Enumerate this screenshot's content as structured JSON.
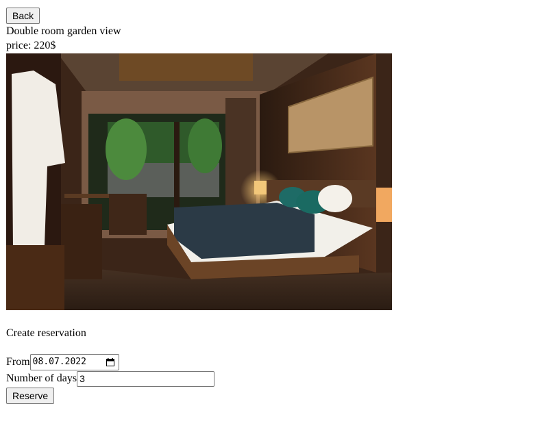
{
  "nav": {
    "back_label": "Back"
  },
  "room": {
    "name": "Double room garden view",
    "price_text": "price: 220$",
    "image_alt": "Hotel room photo"
  },
  "reservation": {
    "title": "Create reservation",
    "from_label": "From",
    "from_value": "08.07.2022",
    "days_label": "Number of days",
    "days_value": "3",
    "submit_label": "Reserve"
  }
}
